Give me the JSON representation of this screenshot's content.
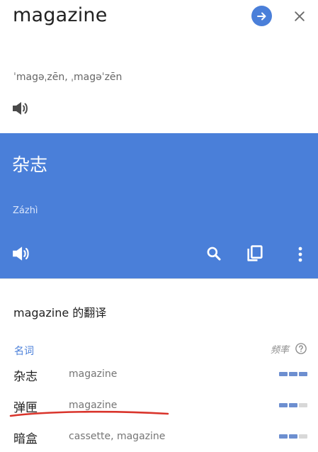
{
  "source": {
    "word": "magazine",
    "phonetic": "ˈmagəˌzēn, ˌmagəˈzēn",
    "icons": {
      "go": "arrow-right-circle-icon",
      "close": "close-icon",
      "speaker": "speaker-icon"
    }
  },
  "translation": {
    "word": "杂志",
    "romanization": "Zázhì",
    "icons": {
      "speaker": "speaker-icon",
      "search": "search-icon",
      "copy": "copy-icon",
      "more": "more-vert-icon"
    }
  },
  "dictionary": {
    "title": "magazine 的翻译",
    "part_of_speech": "名词",
    "frequency_label": "频率",
    "rows": [
      {
        "term": "杂志",
        "synonyms": "magazine",
        "frequency": 3
      },
      {
        "term": "弹匣",
        "synonyms": "magazine",
        "frequency": 2
      },
      {
        "term": "暗盒",
        "synonyms": "cassette, magazine",
        "frequency": 2
      }
    ],
    "frequency_max": 3
  },
  "colors": {
    "accent": "#4a7fd9",
    "annotation_underline": "#d9342b",
    "freq_on": "#6d8fd0",
    "freq_off": "#d8d8d8"
  }
}
